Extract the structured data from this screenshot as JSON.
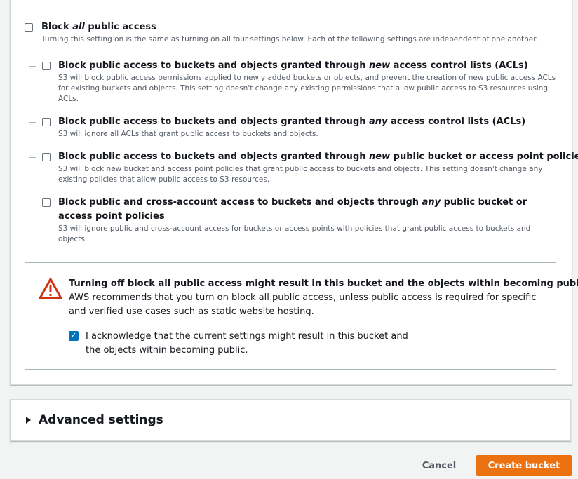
{
  "block_all": {
    "title_prefix": "Block ",
    "title_em": "all",
    "title_suffix": " public access",
    "description": "Turning this setting on is the same as turning on all four settings below. Each of the following settings are independent of one another.",
    "checked": false
  },
  "options": [
    {
      "title_prefix": "Block public access to buckets and objects granted through ",
      "title_em": "new",
      "title_suffix": " access control lists (ACLs)",
      "description": "S3 will block public access permissions applied to newly added buckets or objects, and prevent the creation of new public access ACLs for existing buckets and objects. This setting doesn't change any existing permissions that allow public access to S3 resources using ACLs.",
      "checked": false
    },
    {
      "title_prefix": "Block public access to buckets and objects granted through ",
      "title_em": "any",
      "title_suffix": " access control lists (ACLs)",
      "description": "S3 will ignore all ACLs that grant public access to buckets and objects.",
      "checked": false
    },
    {
      "title_prefix": "Block public access to buckets and objects granted through ",
      "title_em": "new",
      "title_suffix": " public bucket or access point policies",
      "description": "S3 will block new bucket and access point policies that grant public access to buckets and objects. This setting doesn't change any existing policies that allow public access to S3 resources.",
      "checked": false
    },
    {
      "title_prefix": "Block public and cross-account access to buckets and objects through ",
      "title_em": "any",
      "title_suffix": " public bucket or access point policies",
      "description": "S3 will ignore public and cross-account access for buckets or access points with policies that grant public access to buckets and objects.",
      "checked": false
    }
  ],
  "warning": {
    "icon": "warning-triangle-icon",
    "title": "Turning off block all public access might result in this bucket and the objects within becoming public",
    "description": "AWS recommends that you turn on block all public access, unless public access is required for specific and verified use cases such as static website hosting.",
    "acknowledge_label": "I acknowledge that the current settings might result in this bucket and the objects within becoming public.",
    "acknowledge_checked": true
  },
  "advanced": {
    "title": "Advanced settings",
    "expanded": false
  },
  "actions": {
    "cancel_label": "Cancel",
    "create_label": "Create bucket"
  },
  "colors": {
    "primary_button": "#ec7211",
    "checkbox_checked": "#0073bb",
    "warning_icon": "#d13212"
  }
}
